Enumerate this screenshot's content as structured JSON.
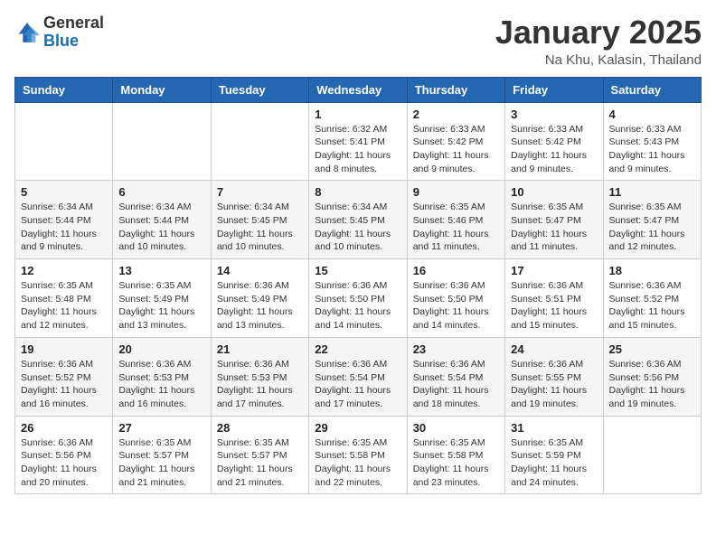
{
  "header": {
    "logo": {
      "line1": "General",
      "line2": "Blue"
    },
    "title": "January 2025",
    "location": "Na Khu, Kalasin, Thailand"
  },
  "weekdays": [
    "Sunday",
    "Monday",
    "Tuesday",
    "Wednesday",
    "Thursday",
    "Friday",
    "Saturday"
  ],
  "weeks": [
    [
      null,
      null,
      null,
      {
        "day": 1,
        "sunrise": "6:32 AM",
        "sunset": "5:41 PM",
        "daylight": "11 hours and 8 minutes."
      },
      {
        "day": 2,
        "sunrise": "6:33 AM",
        "sunset": "5:42 PM",
        "daylight": "11 hours and 9 minutes."
      },
      {
        "day": 3,
        "sunrise": "6:33 AM",
        "sunset": "5:42 PM",
        "daylight": "11 hours and 9 minutes."
      },
      {
        "day": 4,
        "sunrise": "6:33 AM",
        "sunset": "5:43 PM",
        "daylight": "11 hours and 9 minutes."
      }
    ],
    [
      {
        "day": 5,
        "sunrise": "6:34 AM",
        "sunset": "5:44 PM",
        "daylight": "11 hours and 9 minutes."
      },
      {
        "day": 6,
        "sunrise": "6:34 AM",
        "sunset": "5:44 PM",
        "daylight": "11 hours and 10 minutes."
      },
      {
        "day": 7,
        "sunrise": "6:34 AM",
        "sunset": "5:45 PM",
        "daylight": "11 hours and 10 minutes."
      },
      {
        "day": 8,
        "sunrise": "6:34 AM",
        "sunset": "5:45 PM",
        "daylight": "11 hours and 10 minutes."
      },
      {
        "day": 9,
        "sunrise": "6:35 AM",
        "sunset": "5:46 PM",
        "daylight": "11 hours and 11 minutes."
      },
      {
        "day": 10,
        "sunrise": "6:35 AM",
        "sunset": "5:47 PM",
        "daylight": "11 hours and 11 minutes."
      },
      {
        "day": 11,
        "sunrise": "6:35 AM",
        "sunset": "5:47 PM",
        "daylight": "11 hours and 12 minutes."
      }
    ],
    [
      {
        "day": 12,
        "sunrise": "6:35 AM",
        "sunset": "5:48 PM",
        "daylight": "11 hours and 12 minutes."
      },
      {
        "day": 13,
        "sunrise": "6:35 AM",
        "sunset": "5:49 PM",
        "daylight": "11 hours and 13 minutes."
      },
      {
        "day": 14,
        "sunrise": "6:36 AM",
        "sunset": "5:49 PM",
        "daylight": "11 hours and 13 minutes."
      },
      {
        "day": 15,
        "sunrise": "6:36 AM",
        "sunset": "5:50 PM",
        "daylight": "11 hours and 14 minutes."
      },
      {
        "day": 16,
        "sunrise": "6:36 AM",
        "sunset": "5:50 PM",
        "daylight": "11 hours and 14 minutes."
      },
      {
        "day": 17,
        "sunrise": "6:36 AM",
        "sunset": "5:51 PM",
        "daylight": "11 hours and 15 minutes."
      },
      {
        "day": 18,
        "sunrise": "6:36 AM",
        "sunset": "5:52 PM",
        "daylight": "11 hours and 15 minutes."
      }
    ],
    [
      {
        "day": 19,
        "sunrise": "6:36 AM",
        "sunset": "5:52 PM",
        "daylight": "11 hours and 16 minutes."
      },
      {
        "day": 20,
        "sunrise": "6:36 AM",
        "sunset": "5:53 PM",
        "daylight": "11 hours and 16 minutes."
      },
      {
        "day": 21,
        "sunrise": "6:36 AM",
        "sunset": "5:53 PM",
        "daylight": "11 hours and 17 minutes."
      },
      {
        "day": 22,
        "sunrise": "6:36 AM",
        "sunset": "5:54 PM",
        "daylight": "11 hours and 17 minutes."
      },
      {
        "day": 23,
        "sunrise": "6:36 AM",
        "sunset": "5:54 PM",
        "daylight": "11 hours and 18 minutes."
      },
      {
        "day": 24,
        "sunrise": "6:36 AM",
        "sunset": "5:55 PM",
        "daylight": "11 hours and 19 minutes."
      },
      {
        "day": 25,
        "sunrise": "6:36 AM",
        "sunset": "5:56 PM",
        "daylight": "11 hours and 19 minutes."
      }
    ],
    [
      {
        "day": 26,
        "sunrise": "6:36 AM",
        "sunset": "5:56 PM",
        "daylight": "11 hours and 20 minutes."
      },
      {
        "day": 27,
        "sunrise": "6:35 AM",
        "sunset": "5:57 PM",
        "daylight": "11 hours and 21 minutes."
      },
      {
        "day": 28,
        "sunrise": "6:35 AM",
        "sunset": "5:57 PM",
        "daylight": "11 hours and 21 minutes."
      },
      {
        "day": 29,
        "sunrise": "6:35 AM",
        "sunset": "5:58 PM",
        "daylight": "11 hours and 22 minutes."
      },
      {
        "day": 30,
        "sunrise": "6:35 AM",
        "sunset": "5:58 PM",
        "daylight": "11 hours and 23 minutes."
      },
      {
        "day": 31,
        "sunrise": "6:35 AM",
        "sunset": "5:59 PM",
        "daylight": "11 hours and 24 minutes."
      },
      null
    ]
  ],
  "labels": {
    "sunrise": "Sunrise:",
    "sunset": "Sunset:",
    "daylight": "Daylight hours"
  }
}
